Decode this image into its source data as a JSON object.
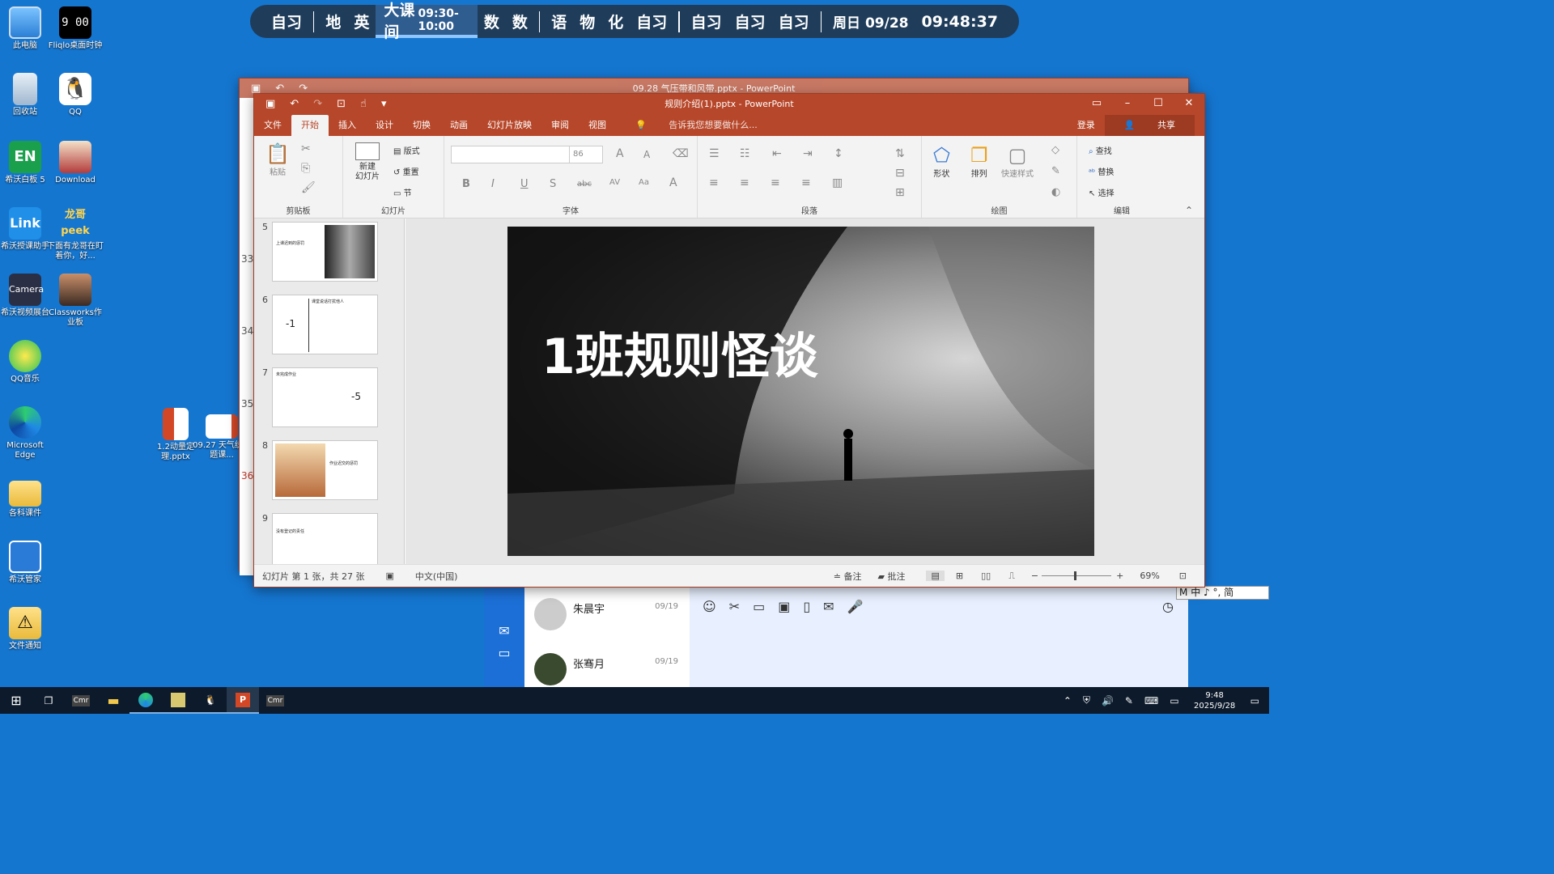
{
  "desktop_icons": [
    {
      "label": "此电脑",
      "icon": "computer-icon"
    },
    {
      "label": "Fliqlo桌面时钟",
      "icon": "flip-clock-icon"
    },
    {
      "label": "回收站",
      "icon": "recycle-bin-icon"
    },
    {
      "label": "QQ",
      "icon": "qq-penguin-icon"
    },
    {
      "label": "希沃白板 5",
      "icon": "seewo-whiteboard-icon"
    },
    {
      "label": "Download",
      "icon": "folder-character-icon"
    },
    {
      "label": "希沃授课助手",
      "icon": "seewo-link-icon"
    },
    {
      "label": "下面有龙哥在盯着你，好...",
      "icon": "dragon-peek-icon"
    },
    {
      "label": "希沃视频展台",
      "icon": "seewo-camera-icon"
    },
    {
      "label": "Classworks作业板",
      "icon": "classworks-icon"
    },
    {
      "label": "QQ音乐",
      "icon": "qq-music-icon"
    },
    {
      "label": "Microsoft Edge",
      "icon": "edge-icon"
    },
    {
      "label": "各科课件",
      "icon": "folder-icon"
    },
    {
      "label": "希沃管家",
      "icon": "seewo-guard-icon"
    },
    {
      "label": "文件通知",
      "icon": "warning-folder-icon"
    },
    {
      "label": "1.2动量定理.pptx",
      "icon": "pptx-file-icon"
    },
    {
      "label": "09.27 天气统习题课...",
      "icon": "pptx-file-icon"
    }
  ],
  "schedule": {
    "items": [
      "自习",
      "地",
      "英",
      "大课间",
      "数",
      "数",
      "语",
      "物",
      "化",
      "自习",
      "自习",
      "自习",
      "自习"
    ],
    "current_time": "09:30-10:00",
    "date": "周日 09/28",
    "clock": "09:48:37"
  },
  "bg_window": {
    "title": "09.28 气压带和风带.pptx - PowerPoint",
    "side_numbers": [
      "33",
      "34",
      "35",
      "36"
    ]
  },
  "ppt": {
    "title": "规则介绍(1).pptx - PowerPoint",
    "tabs": [
      "文件",
      "开始",
      "插入",
      "设计",
      "切换",
      "动画",
      "幻灯片放映",
      "审阅",
      "视图"
    ],
    "tellme": "告诉我您想要做什么...",
    "login": "登录",
    "share": "共享",
    "groups": {
      "clipboard": "剪贴板",
      "slides": "幻灯片",
      "font": "字体",
      "paragraph": "段落",
      "drawing": "绘图",
      "editing": "编辑"
    },
    "buttons": {
      "paste": "粘贴",
      "new_slide": "新建\n幻灯片",
      "layout": "版式",
      "reset": "重置",
      "section": "节",
      "font_size": "86",
      "shape": "形状",
      "arrange": "排列",
      "quick_style": "快速样式",
      "find": "查找",
      "replace": "替换",
      "select": "选择"
    },
    "thumbnails": [
      {
        "num": "5",
        "title": "上课迟到的惩罚",
        "value": ""
      },
      {
        "num": "6",
        "title": "课堂说话打扰他人",
        "value": "-1"
      },
      {
        "num": "7",
        "title": "未完成作业",
        "value": "-5"
      },
      {
        "num": "8",
        "title": "作业迟交的惩罚",
        "value": ""
      },
      {
        "num": "9",
        "title": "没有登记的责任",
        "value": ""
      }
    ],
    "slide_title": "1班规则怪谈",
    "status": {
      "slide_info": "幻灯片 第 1 张，共 27 张",
      "language": "中文(中国)",
      "notes": "备注",
      "comments": "批注",
      "zoom": "69%"
    }
  },
  "qq": {
    "contacts": [
      {
        "name": "朱晨宇",
        "date": "09/19"
      },
      {
        "name": "张骞月",
        "date": "09/19"
      }
    ]
  },
  "ime": "中 ♪ °, 简",
  "taskbar": {
    "time": "9:48",
    "date": "2025/9/28"
  }
}
